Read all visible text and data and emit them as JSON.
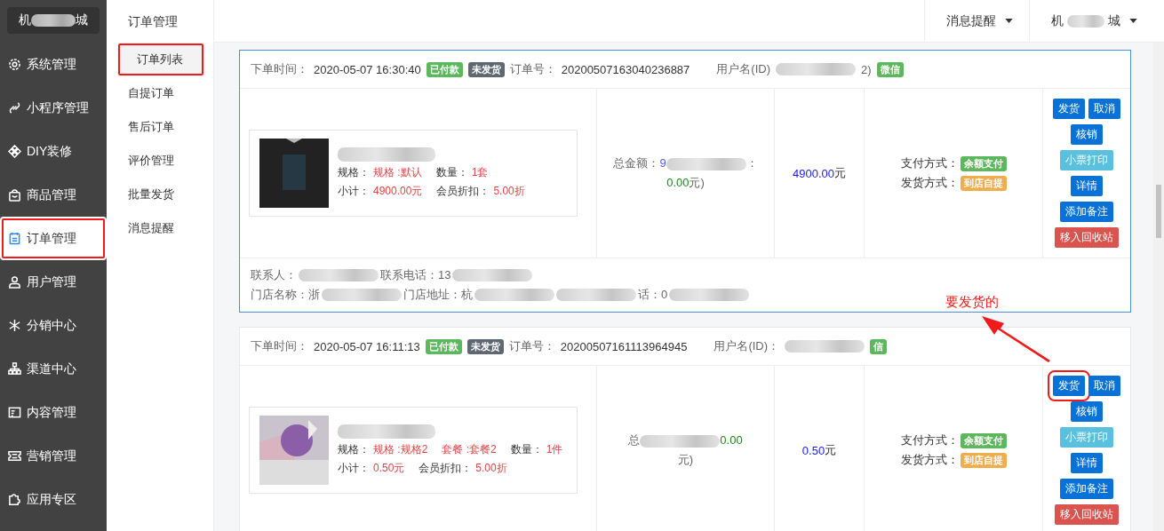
{
  "sidebar": {
    "brand": {
      "prefix": "机",
      "suffix": "城"
    },
    "items": [
      {
        "label": "系统管理",
        "selected": false,
        "highlighted": false
      },
      {
        "label": "小程序管理",
        "selected": false,
        "highlighted": false
      },
      {
        "label": "DIY装修",
        "selected": false,
        "highlighted": false
      },
      {
        "label": "商品管理",
        "selected": false,
        "highlighted": false
      },
      {
        "label": "订单管理",
        "selected": true,
        "highlighted": true
      },
      {
        "label": "用户管理",
        "selected": false,
        "highlighted": false
      },
      {
        "label": "分销中心",
        "selected": false,
        "highlighted": false
      },
      {
        "label": "渠道中心",
        "selected": false,
        "highlighted": false
      },
      {
        "label": "内容管理",
        "selected": false,
        "highlighted": false
      },
      {
        "label": "营销管理",
        "selected": false,
        "highlighted": false
      },
      {
        "label": "应用专区",
        "selected": false,
        "highlighted": false
      }
    ]
  },
  "submenu": {
    "title": "订单管理",
    "items": [
      {
        "label": "订单列表",
        "selected": true,
        "highlighted": true
      },
      {
        "label": "自提订单",
        "selected": false,
        "highlighted": false
      },
      {
        "label": "售后订单",
        "selected": false,
        "highlighted": false
      },
      {
        "label": "评价管理",
        "selected": false,
        "highlighted": false
      },
      {
        "label": "批量发货",
        "selected": false,
        "highlighted": false
      },
      {
        "label": "消息提醒",
        "selected": false,
        "highlighted": false
      }
    ]
  },
  "topbar": {
    "items": [
      {
        "prefix": "消息提醒"
      },
      {
        "prefix": "机",
        "suffix": "城"
      }
    ]
  },
  "orders": [
    {
      "selected": true,
      "time_label": "下单时间：",
      "time": "2020-05-07 16:30:40",
      "tags": [
        {
          "text": "已付款",
          "color": "#5cb85c"
        },
        {
          "text": "未发货",
          "color": "#5e6873"
        }
      ],
      "order_no_label": "订单号：",
      "order_no": "20200507163040236887",
      "user_label": "用户名(ID)",
      "user_tail": "2)",
      "channel": "微信",
      "product": {
        "specs": [
          {
            "label": "规格：",
            "value": "规格 :默认"
          },
          {
            "label": "数量：",
            "value": "1套"
          }
        ],
        "subtotal_label": "小计：",
        "subtotal": "4900.00元",
        "discount_label": "会员折扣：",
        "discount": "5.00折"
      },
      "total": [
        {
          "kind": "text",
          "text": "总金额："
        },
        {
          "kind": "blue",
          "text": "9"
        },
        {
          "kind": "blur"
        },
        {
          "kind": "text",
          "text": "："
        },
        {
          "kind": "break"
        },
        {
          "kind": "green",
          "text": "0.00"
        },
        {
          "kind": "text",
          "text": "元)"
        }
      ],
      "price": "4900.00",
      "price_unit": "元",
      "payment": [
        {
          "label": "支付方式：",
          "badge": "余额支付",
          "color": "#5cb85c"
        },
        {
          "label": "发货方式：",
          "badge": "到店自提",
          "color": "#f0ad4e"
        }
      ],
      "actions": [
        {
          "label": "发货",
          "kind": "primary",
          "highlighted": false
        },
        {
          "label": "取消",
          "kind": "primary",
          "highlighted": false
        },
        {
          "label": "核销",
          "kind": "primary",
          "highlighted": false
        },
        {
          "label": "小票打印",
          "kind": "info",
          "highlighted": false
        },
        {
          "label": "详情",
          "kind": "primary",
          "highlighted": false
        },
        {
          "label": "添加备注",
          "kind": "primary",
          "highlighted": false
        },
        {
          "label": "移入回收站",
          "kind": "danger",
          "highlighted": false
        }
      ],
      "footer": [
        [
          {
            "kind": "text",
            "text": "联系人："
          },
          {
            "kind": "blur"
          },
          {
            "kind": "text",
            "text": "联系电话：13"
          },
          {
            "kind": "blur"
          }
        ],
        [
          {
            "kind": "text",
            "text": "门店名称：浙"
          },
          {
            "kind": "blur"
          },
          {
            "kind": "text",
            "text": "门店地址：杭"
          },
          {
            "kind": "blur"
          },
          {
            "kind": "blur"
          },
          {
            "kind": "text",
            "text": "话：0"
          },
          {
            "kind": "blur"
          }
        ]
      ]
    },
    {
      "selected": false,
      "time_label": "下单时间：",
      "time": "2020-05-07 16:11:13",
      "tags": [
        {
          "text": "已付款",
          "color": "#5cb85c"
        },
        {
          "text": "未发货",
          "color": "#5e6873"
        }
      ],
      "order_no_label": "订单号：",
      "order_no": "20200507161113964945",
      "user_label": "用户名(ID)：",
      "channel": "信",
      "product": {
        "specs": [
          {
            "label": "规格：",
            "value": "规格 :规格2"
          },
          {
            "value": "套餐 :套餐2"
          },
          {
            "label": "数量：",
            "value": "1件"
          }
        ],
        "subtotal_label": "小计：",
        "subtotal": "0.50元",
        "discount_label": "会员折扣：",
        "discount": "5.00折"
      },
      "total": [
        {
          "kind": "text",
          "text": "总"
        },
        {
          "kind": "blur"
        },
        {
          "kind": "green",
          "text": "0.00"
        },
        {
          "kind": "break"
        },
        {
          "kind": "text",
          "text": "元)"
        }
      ],
      "price": "0.50",
      "price_unit": "元",
      "payment": [
        {
          "label": "支付方式：",
          "badge": "余额支付",
          "color": "#5cb85c"
        },
        {
          "label": "发货方式：",
          "badge": "到店自提",
          "color": "#f0ad4e"
        }
      ],
      "actions": [
        {
          "label": "发货",
          "kind": "primary",
          "highlighted": true
        },
        {
          "label": "取消",
          "kind": "primary",
          "highlighted": false
        },
        {
          "label": "核销",
          "kind": "primary",
          "highlighted": false
        },
        {
          "label": "小票打印",
          "kind": "info",
          "highlighted": false
        },
        {
          "label": "详情",
          "kind": "primary",
          "highlighted": false
        },
        {
          "label": "添加备注",
          "kind": "primary",
          "highlighted": false
        },
        {
          "label": "移入回收站",
          "kind": "danger",
          "highlighted": false
        }
      ]
    }
  ],
  "annotation": {
    "note": "要发货的"
  }
}
